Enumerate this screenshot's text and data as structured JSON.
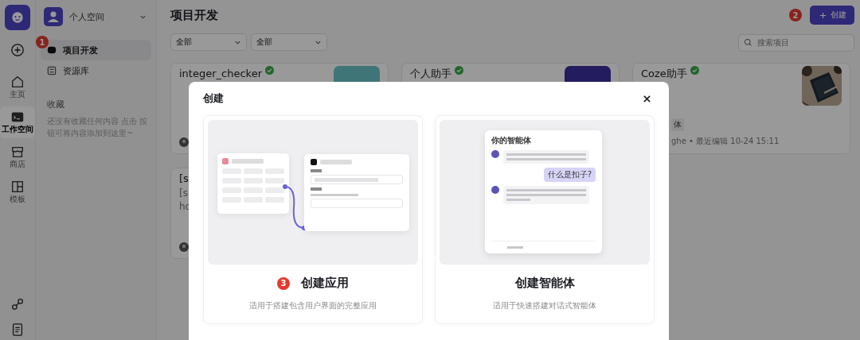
{
  "rail": {
    "items": [
      {
        "label": "主页",
        "kind": "home",
        "selected": false
      },
      {
        "label": "工作空间",
        "kind": "workspace",
        "selected": true
      },
      {
        "label": "商店",
        "kind": "store",
        "selected": false
      },
      {
        "label": "模板",
        "kind": "template",
        "selected": false
      }
    ]
  },
  "sidebar": {
    "workspace": "个人空间",
    "items": [
      {
        "label": "项目开发",
        "kind": "project",
        "selected": true,
        "marker": "1"
      },
      {
        "label": "资源库",
        "kind": "library",
        "selected": false
      }
    ],
    "favorites": {
      "title": "收藏",
      "empty": "还没有收藏任何内容 点击 按钮可将内容添加到这里~"
    }
  },
  "header": {
    "title": "项目开发",
    "marker": "2",
    "create_button": "创建"
  },
  "filters": [
    {
      "value": "全部"
    },
    {
      "value": "全部"
    }
  ],
  "search": {
    "placeholder": "搜索项目"
  },
  "cards": [
    {
      "title": "integer_checker",
      "verified": true,
      "thumbnail": {
        "kind": "block"
      },
      "avatar": true
    },
    {
      "title": "个人助手",
      "verified": true,
      "thumbnail": {
        "kind": "block"
      }
    },
    {
      "title": "Coze助手",
      "verified": true,
      "tag": "体",
      "meta": "ghe • 最近编辑 10-24 15:11"
    },
    {
      "title": "[s",
      "lines": [
        "[s",
        "hc"
      ],
      "avatar": true
    }
  ],
  "modal": {
    "title": "创建",
    "options": [
      {
        "kind": "app",
        "title": "创建应用",
        "marker": "3",
        "description": "适用于搭建包含用户界面的完整应用"
      },
      {
        "kind": "agent",
        "title": "创建智能体",
        "description": "适用于快速搭建对话式智能体",
        "chat_title": "你的智能体",
        "user_message": "什么是扣子?"
      }
    ]
  }
}
